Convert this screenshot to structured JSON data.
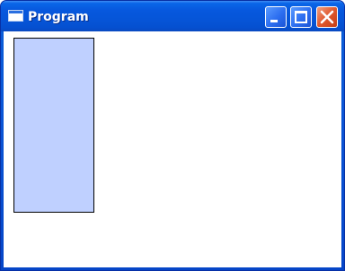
{
  "window": {
    "title": "Program",
    "icons": {
      "app": "window-app-icon",
      "minimize": "minimize-icon",
      "maximize": "maximize-icon",
      "close": "close-icon"
    }
  },
  "colors": {
    "titlebar": "#0758de",
    "close_button": "#e0582e",
    "panel_fill": "#bfd0ff",
    "panel_border": "#000000",
    "client_background": "#ffffff"
  }
}
